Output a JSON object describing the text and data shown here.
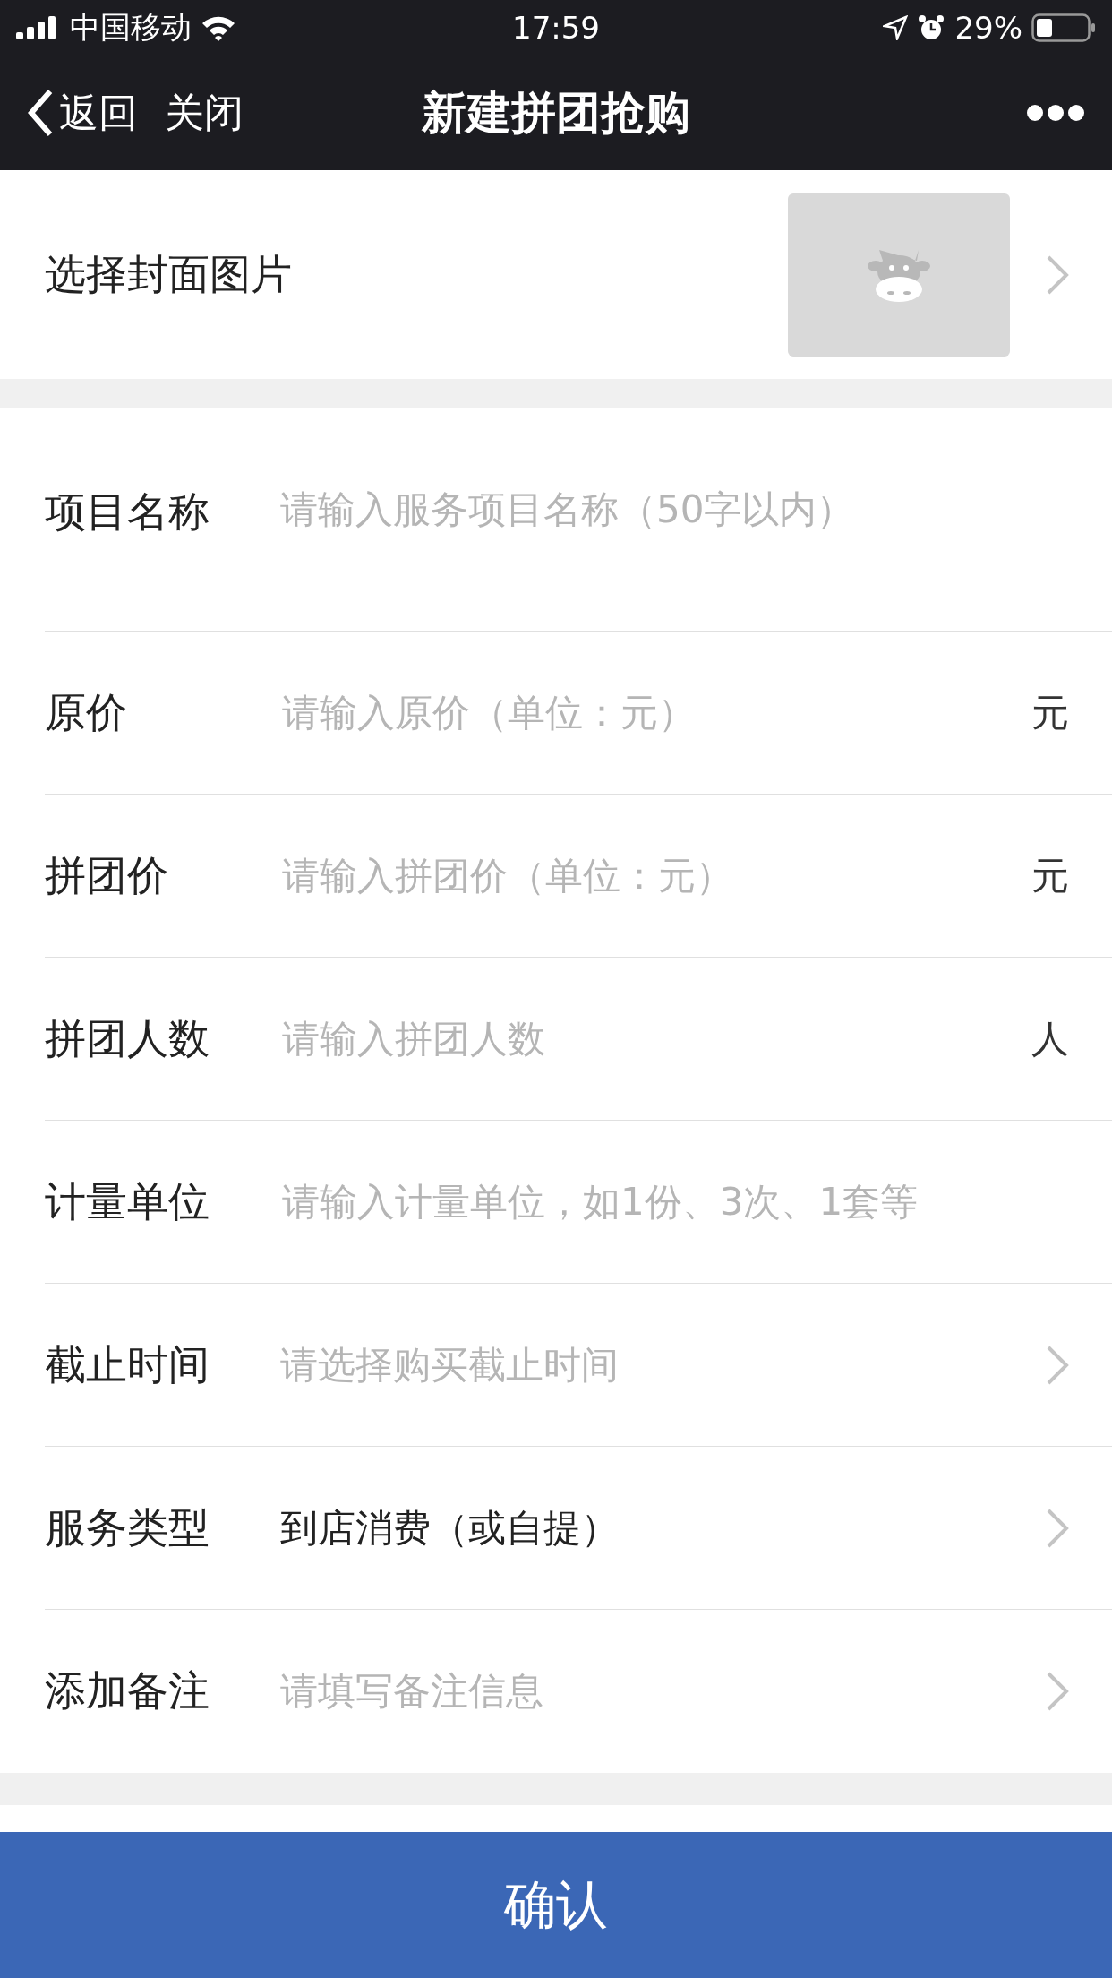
{
  "status_bar": {
    "carrier": "中国移动",
    "time": "17:59",
    "battery": "29%"
  },
  "nav": {
    "back": "返回",
    "close": "关闭",
    "title": "新建拼团抢购"
  },
  "cover": {
    "label": "选择封面图片"
  },
  "fields": [
    {
      "kind": "textarea",
      "label": "项目名称",
      "placeholder": "请输入服务项目名称（50字以内）"
    },
    {
      "kind": "input",
      "label": "原价",
      "placeholder": "请输入原价（单位：元）",
      "unit": "元"
    },
    {
      "kind": "input",
      "label": "拼团价",
      "placeholder": "请输入拼团价（单位：元）",
      "unit": "元"
    },
    {
      "kind": "input",
      "label": "拼团人数",
      "placeholder": "请输入拼团人数",
      "unit": "人"
    },
    {
      "kind": "input",
      "label": "计量单位",
      "placeholder": "请输入计量单位，如1份、3次、1套等"
    },
    {
      "kind": "select",
      "label": "截止时间",
      "placeholder": "请选择购买截止时间"
    },
    {
      "kind": "select",
      "label": "服务类型",
      "value": "到店消费（或自提）"
    },
    {
      "kind": "select",
      "label": "添加备注",
      "placeholder": "请填写备注信息"
    }
  ],
  "confirm": "确认"
}
